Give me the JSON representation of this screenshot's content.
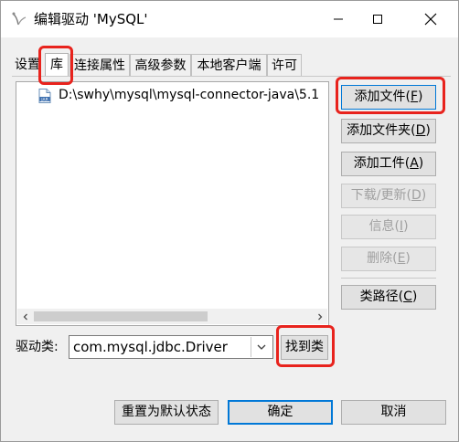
{
  "window": {
    "title": "编辑驱动 'MySQL'",
    "icon": "driver-app-icon"
  },
  "tabs": [
    {
      "label": "设置",
      "active": false
    },
    {
      "label": "库",
      "active": true
    },
    {
      "label": "连接属性",
      "active": false
    },
    {
      "label": "高级参数",
      "active": false
    },
    {
      "label": "本地客户端",
      "active": false
    },
    {
      "label": "许可",
      "active": false
    }
  ],
  "library_list": {
    "items": [
      {
        "path": "D:\\swhy\\mysql\\mysql-connector-java\\5.1",
        "icon": "jar-file-icon"
      }
    ]
  },
  "side_buttons": {
    "add_file": {
      "text": "添加文件(",
      "key": "F",
      "end": ")"
    },
    "add_folder": {
      "text": "添加文件夹(",
      "key": "D",
      "end": ")"
    },
    "add_artifact": {
      "text": "添加工件(",
      "key": "A",
      "end": ")"
    },
    "download_update": {
      "text": "下载/更新(",
      "key": "D",
      "end": ")",
      "disabled": true
    },
    "info": {
      "text": "信息(",
      "key": "I",
      "end": ")",
      "disabled": true
    },
    "delete": {
      "text": "删除(",
      "key": "E",
      "end": ")",
      "disabled": true
    },
    "classpath": {
      "text": "类路径(",
      "key": "C",
      "end": ")"
    }
  },
  "driver_class": {
    "label": "驱动类:",
    "value": "com.mysql.jdbc.Driver",
    "find_button": "找到类"
  },
  "footer": {
    "reset_label": "重置为默认状态",
    "ok_label": "确定",
    "cancel_label": "取消"
  },
  "colors": {
    "highlight": "#e8231d",
    "focus": "#0078d7"
  }
}
